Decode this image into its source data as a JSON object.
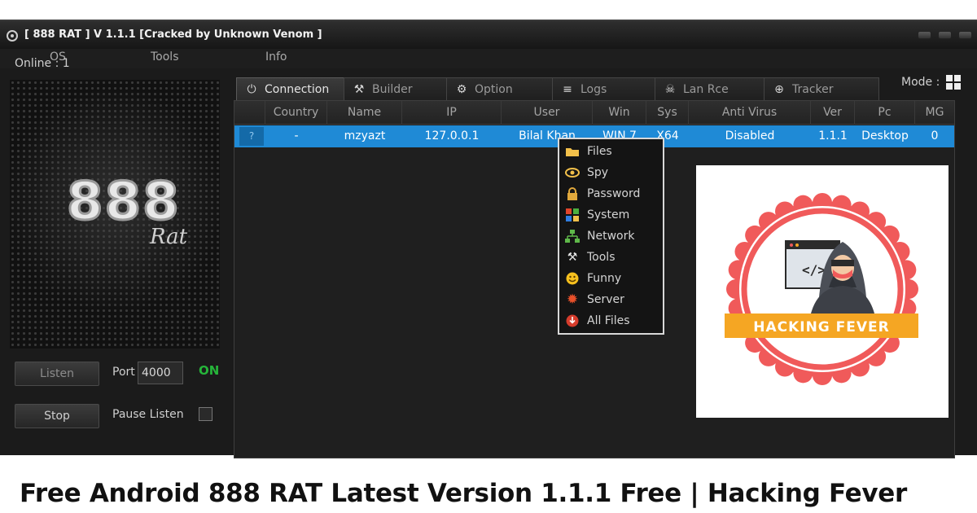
{
  "window": {
    "title": "[ 888 RAT ] V 1.1.1 [Cracked by Unknown Venom ]"
  },
  "menu": [
    "OS",
    "Tools",
    "Info"
  ],
  "left_panel": {
    "online_label": "Online : 1",
    "logo_text": "888",
    "logo_sub": "Rat",
    "listen_label": "Listen",
    "port_label": "Port",
    "port_value": "4000",
    "status": "ON",
    "stop_label": "Stop",
    "pause_label": "Pause Listen"
  },
  "tabs": [
    {
      "label": "Connection",
      "icon": "plug-icon"
    },
    {
      "label": "Builder",
      "icon": "tools-icon"
    },
    {
      "label": "Option",
      "icon": "gear-icon"
    },
    {
      "label": "Logs",
      "icon": "list-icon"
    },
    {
      "label": "Lan Rce",
      "icon": "skull-icon"
    },
    {
      "label": "Tracker",
      "icon": "globe-icon"
    }
  ],
  "mode_label": "Mode :",
  "table": {
    "columns": [
      "Country",
      "Name",
      "IP",
      "User",
      "Win",
      "Sys",
      "Anti Virus",
      "Ver",
      "Pc",
      "MG"
    ],
    "rows": [
      {
        "country_flag": "?",
        "country": "-",
        "name": "mzyazt",
        "ip": "127.0.0.1",
        "user": "Bilal Khan",
        "win": "WIN 7",
        "sys": "X64",
        "antivirus": "Disabled",
        "ver": "1.1.1",
        "pc": "Desktop",
        "mg": "0"
      }
    ]
  },
  "context_menu": [
    {
      "label": "Files",
      "icon": "folder-icon"
    },
    {
      "label": "Spy",
      "icon": "eye-icon"
    },
    {
      "label": "Password",
      "icon": "lock-icon"
    },
    {
      "label": "System",
      "icon": "windows-icon"
    },
    {
      "label": "Network",
      "icon": "network-icon"
    },
    {
      "label": "Tools",
      "icon": "tools-icon"
    },
    {
      "label": "Funny",
      "icon": "smiley-icon"
    },
    {
      "label": "Server",
      "icon": "server-icon"
    },
    {
      "label": "All Files",
      "icon": "download-icon"
    }
  ],
  "badge": {
    "text": "HACKING FEVER",
    "code_symbol": "</>",
    "colors": {
      "ring": "#f05a5a",
      "banner": "#f5a623"
    }
  },
  "caption": "Free Android 888 RAT Latest Version 1.1.1 Free | Hacking Fever"
}
